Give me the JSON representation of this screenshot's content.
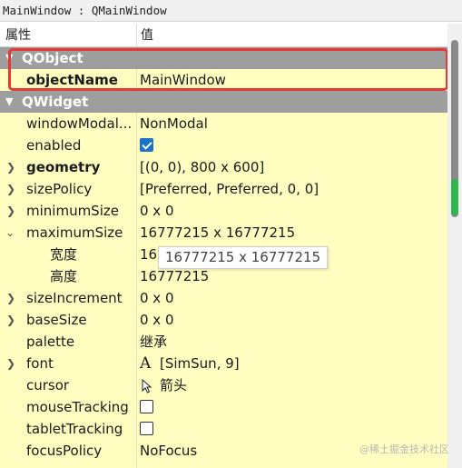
{
  "title": "MainWindow : QMainWindow",
  "header": {
    "col1": "属性",
    "col2": "值"
  },
  "groups": {
    "qobject": "QObject",
    "qwidget": "QWidget"
  },
  "rows": {
    "objectName": {
      "name": "objectName",
      "value": "MainWindow"
    },
    "windowModality": {
      "name": "windowModal...",
      "value": "NonModal"
    },
    "enabled": {
      "name": "enabled",
      "checked": true
    },
    "geometry": {
      "name": "geometry",
      "value": "[(0, 0), 800 x 600]"
    },
    "sizePolicy": {
      "name": "sizePolicy",
      "value": "[Preferred, Preferred, 0, 0]"
    },
    "minimumSize": {
      "name": "minimumSize",
      "value": "0 x 0"
    },
    "maximumSize": {
      "name": "maximumSize",
      "value": "16777215 x 16777215"
    },
    "width": {
      "name": "宽度",
      "value": "16"
    },
    "height": {
      "name": "高度",
      "value": "16777215"
    },
    "sizeIncrement": {
      "name": "sizeIncrement",
      "value": "0 x 0"
    },
    "baseSize": {
      "name": "baseSize",
      "value": "0 x 0"
    },
    "palette": {
      "name": "palette",
      "value": "继承"
    },
    "font": {
      "name": "font",
      "icon": "A",
      "value": "[SimSun, 9]"
    },
    "cursor": {
      "name": "cursor",
      "icon": "arrow-cursor-icon",
      "value": "箭头"
    },
    "mouseTracking": {
      "name": "mouseTracking",
      "checked": false
    },
    "tabletTracking": {
      "name": "tabletTracking",
      "checked": false
    },
    "focusPolicy": {
      "name": "focusPolicy",
      "value": "NoFocus"
    }
  },
  "tooltip": "16777215 x 16777215",
  "watermark": "@稀土掘金技术社区",
  "colors": {
    "row_bg": "#fffdbf",
    "group_bg": "#9e9e9e",
    "highlight": "#e53935",
    "checkbox": "#1a73c9"
  }
}
